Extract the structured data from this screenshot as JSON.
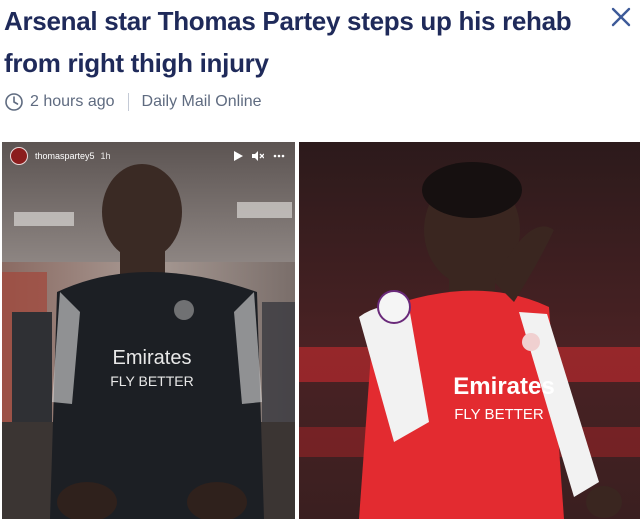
{
  "article": {
    "headline": "Arsenal star Thomas Partey steps up his rehab from right thigh injury",
    "time_ago": "2 hours ago",
    "source": "Daily Mail Online"
  },
  "instagram_story": {
    "username": "thomaspartey5",
    "time": "1h"
  },
  "icons": {
    "close": "close-icon",
    "clock": "clock-icon",
    "play": "play-icon",
    "mute": "mute-icon",
    "more": "more-icon"
  },
  "colors": {
    "headline": "#1f2a5a",
    "meta_text": "#5f6b80",
    "close": "#3d5a99"
  }
}
